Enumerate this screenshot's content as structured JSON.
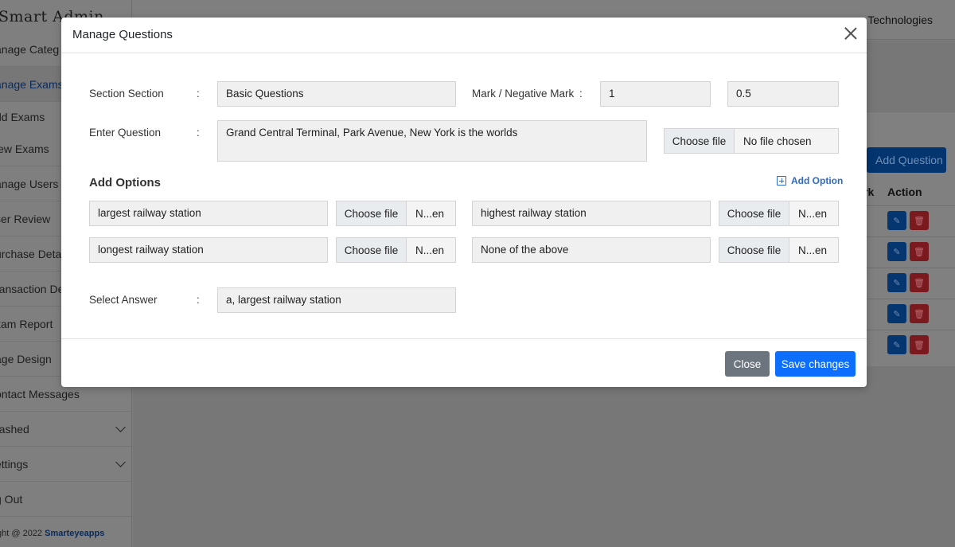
{
  "app": {
    "brand": "Smart Admin",
    "company": "e Technologies",
    "copyright_prefix": "ght @ 2022 ",
    "copyright_link": "Smarteyeapps"
  },
  "sidebar": {
    "items": [
      {
        "label": "anage Categ"
      },
      {
        "label": "anage Exams"
      },
      {
        "label": "dd Exams"
      },
      {
        "label": "iew Exams"
      },
      {
        "label": "anage Users"
      },
      {
        "label": "ser Review"
      },
      {
        "label": "urchase Deta"
      },
      {
        "label": "ransaction De"
      },
      {
        "label": "xam Report"
      },
      {
        "label": "age Design"
      },
      {
        "label": "ontact Messages"
      },
      {
        "label": "rashed"
      },
      {
        "label": "ettings"
      },
      {
        "label": "g Out"
      }
    ]
  },
  "table": {
    "add_question_label": "Add Question",
    "col_mark_fragment": "rk",
    "col_action": "Action",
    "edit_icon": "edit-icon",
    "delete_icon": "trash-icon"
  },
  "modal": {
    "title": "Manage Questions",
    "section_label": "Section Section",
    "section_value": "Basic Questions",
    "mark_label": "Mark / Negative Mark",
    "mark_value": "1",
    "negative_mark_value": "0.5",
    "question_label": "Enter Question",
    "question_value": "Grand Central Terminal, Park Avenue, New York is the worlds",
    "question_file_button": "Choose file",
    "question_file_status": "No file chosen",
    "add_options_heading": "Add Options",
    "add_option_link": "Add Option",
    "options": [
      {
        "text": "largest railway station",
        "file_button": "Choose file",
        "file_status": "N...en"
      },
      {
        "text": "highest railway station",
        "file_button": "Choose file",
        "file_status": "N...en"
      },
      {
        "text": "longest railway station",
        "file_button": "Choose file",
        "file_status": "N...en"
      },
      {
        "text": "None of the above",
        "file_button": "Choose file",
        "file_status": "N...en"
      }
    ],
    "answer_label": "Select Answer",
    "answer_value": "a, largest railway station",
    "colon": ":",
    "close_button": "Close",
    "save_button": "Save changes"
  },
  "colors": {
    "primary": "#0d6efd",
    "secondary": "#6c757d",
    "link": "#2d6ac9",
    "field_bg": "#f0f0f0"
  }
}
